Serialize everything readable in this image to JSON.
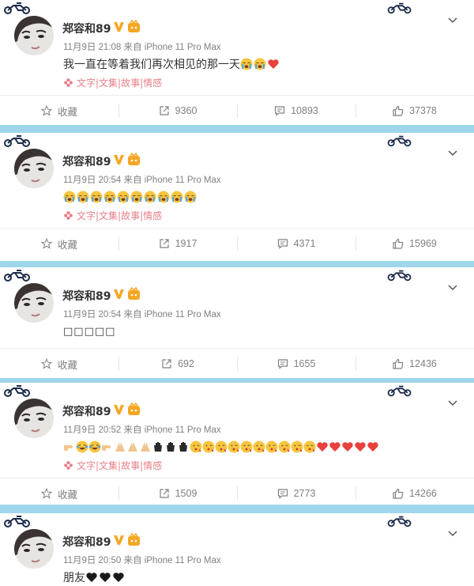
{
  "colors": {
    "page_bg": "#9fd6ec",
    "card_bg": "#ffffff",
    "text": "#333333",
    "meta": "#808080",
    "tag": "#e87f89",
    "badge": "#f5a623",
    "heart": "#e8413d"
  },
  "posts": [
    {
      "username": "郑容和89",
      "meta": "11月9日 21:08 来自 iPhone 11 Pro Max",
      "text": "我一直在等着我们再次相见的那一天",
      "emojis": [
        "crying-face",
        "crying-face",
        "red-heart"
      ],
      "tag": "文字|文集|故事|情感",
      "actions": {
        "favorite": "收藏",
        "repost": "9360",
        "comment": "10893",
        "like": "37378"
      }
    },
    {
      "username": "郑容和89",
      "meta": "11月9日 20:54 来自 iPhone 11 Pro Max",
      "text": "",
      "emojis": [
        "crying-face",
        "crying-face",
        "crying-face",
        "crying-face",
        "crying-face",
        "crying-face",
        "crying-face",
        "crying-face",
        "crying-face",
        "crying-face"
      ],
      "tag": "文字|文集|故事|情感",
      "actions": {
        "favorite": "收藏",
        "repost": "1917",
        "comment": "4371",
        "like": "15969"
      }
    },
    {
      "username": "郑容和89",
      "meta": "11月9日 20:54 来自 iPhone 11 Pro Max",
      "text": "□□□□□",
      "emojis": [],
      "tag": "",
      "actions": {
        "favorite": "收藏",
        "repost": "692",
        "comment": "1655",
        "like": "12436"
      }
    },
    {
      "username": "郑容和89",
      "meta": "11月9日 20:52 来自 iPhone 11 Pro Max",
      "text": "",
      "emojis": [
        "pointing-hand",
        "tears-of-joy",
        "tears-of-joy",
        "pointing-hand",
        "praying-hands",
        "praying-hands",
        "praying-hands",
        "waving-hand",
        "waving-hand",
        "waving-hand",
        "kissing-face",
        "kissing-face",
        "kissing-face",
        "kissing-face",
        "kissing-face",
        "kissing-face",
        "kissing-face",
        "kissing-face",
        "kissing-face",
        "kissing-face",
        "red-heart",
        "red-heart",
        "red-heart",
        "red-heart",
        "red-heart"
      ],
      "tag": "文字|文集|故事|情感",
      "actions": {
        "favorite": "收藏",
        "repost": "1509",
        "comment": "2773",
        "like": "14266"
      }
    },
    {
      "username": "郑容和89",
      "meta": "11月9日 20:50 来自 iPhone 11 Pro Max",
      "text": "朋友",
      "emojis": [
        "black-heart",
        "black-heart",
        "black-heart"
      ],
      "tag": "",
      "actions": {
        "favorite": "",
        "repost": "",
        "comment": "",
        "like": ""
      }
    }
  ]
}
